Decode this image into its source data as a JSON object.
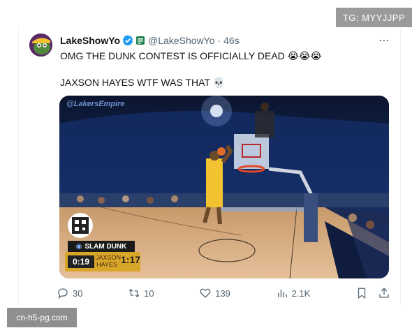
{
  "watermarks": {
    "top": "TG: MYYJJPP",
    "bottom": "cn-h5-pg.com"
  },
  "tweet": {
    "display_name": "LakeShowYo",
    "handle": "@LakeShowYo",
    "time": "· 46s",
    "line1": "OMG THE DUNK CONTEST IS OFFICIALLY DEAD 😭😭😭",
    "line2": "JAXSON HAYES WTF WAS THAT 💀",
    "more_icon": "⋯"
  },
  "media": {
    "channel_tag": "@LakersEmpire",
    "scoreboard": {
      "title": "SLAM DUNK",
      "clock": "0:19",
      "player": "JAXSON HAYES",
      "shot_clock": "1:17"
    }
  },
  "actions": {
    "reply_count": "30",
    "retweet_count": "10",
    "like_count": "139",
    "view_count": "2.1K"
  },
  "colors": {
    "verified": "#1d9bf0",
    "secondary_text": "#536471",
    "scoreboard_gold": "#d8a72a"
  }
}
